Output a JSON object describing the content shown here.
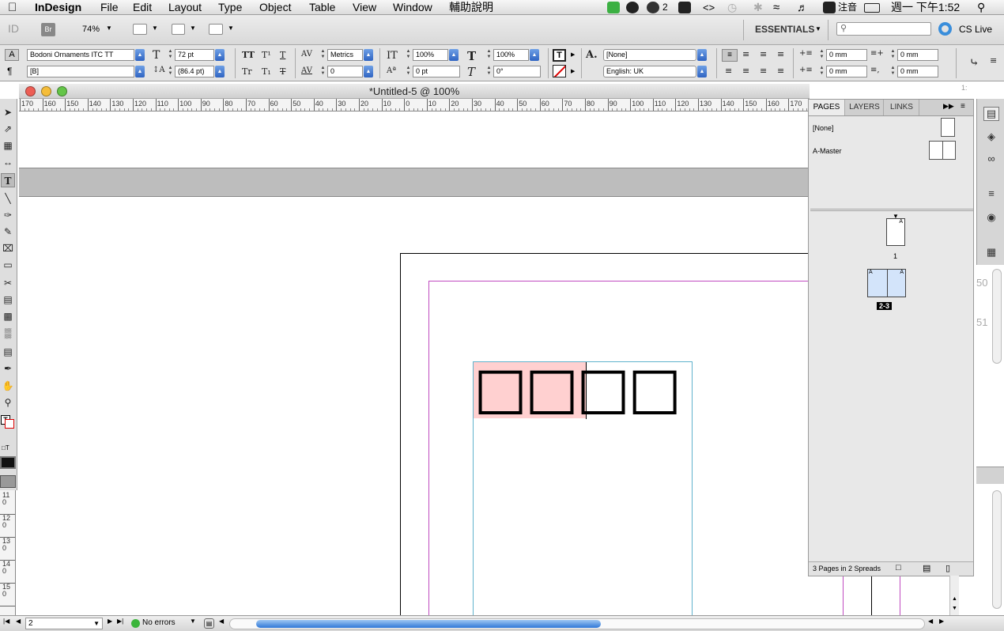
{
  "menubar": {
    "app_name": "InDesign",
    "items": [
      "File",
      "Edit",
      "Layout",
      "Type",
      "Object",
      "Table",
      "View",
      "Window",
      "輔助說明"
    ],
    "status_count": "2",
    "ime_label": "注音",
    "clock": "週一 下午1:52"
  },
  "appbar": {
    "bridge_label": "Br",
    "zoom": "74%",
    "workspace": "ESSENTIALS",
    "cs_live": "CS Live"
  },
  "control": {
    "font_family": "Bodoni Ornaments ITC TT",
    "font_style": "[B]",
    "font_size": "72 pt",
    "leading": "(86.4 pt)",
    "kerning": "Metrics",
    "tracking": "0",
    "vscale": "100%",
    "hscale": "100%",
    "baseline": "0 pt",
    "skew": "0°",
    "char_style": "[None]",
    "language": "English: UK",
    "indent_left": "0 mm",
    "indent_right": "0 mm",
    "first_indent": "0 mm",
    "last_indent": "0 mm"
  },
  "document": {
    "title": "*Untitled-5 @ 100%",
    "placeholder_glyphs": "□□□□"
  },
  "ruler": {
    "h_labels": [
      "170",
      "160",
      "150",
      "140",
      "130",
      "120",
      "110",
      "100",
      "90",
      "80",
      "70",
      "60",
      "50",
      "40",
      "30",
      "20",
      "10",
      "0",
      "10",
      "20",
      "30",
      "40",
      "50",
      "60",
      "70",
      "80",
      "90",
      "100",
      "110",
      "120",
      "130",
      "140",
      "150",
      "160",
      "170"
    ],
    "v_labels": [
      "1 1 0",
      "1 2 0",
      "1 3 0",
      "1 4 0",
      "1 5 0"
    ]
  },
  "pages_panel": {
    "tabs": [
      "PAGES",
      "LAYERS",
      "LINKS"
    ],
    "masters": [
      "[None]",
      "A-Master"
    ],
    "page1_label": "1",
    "spread_label": "2-3",
    "summary": "3 Pages in 2 Spreads"
  },
  "statusbar": {
    "page": "2",
    "preflight": "No errors"
  },
  "background_window": {
    "numbers": [
      "50",
      "51"
    ],
    "ruler_fragment": "1:"
  }
}
